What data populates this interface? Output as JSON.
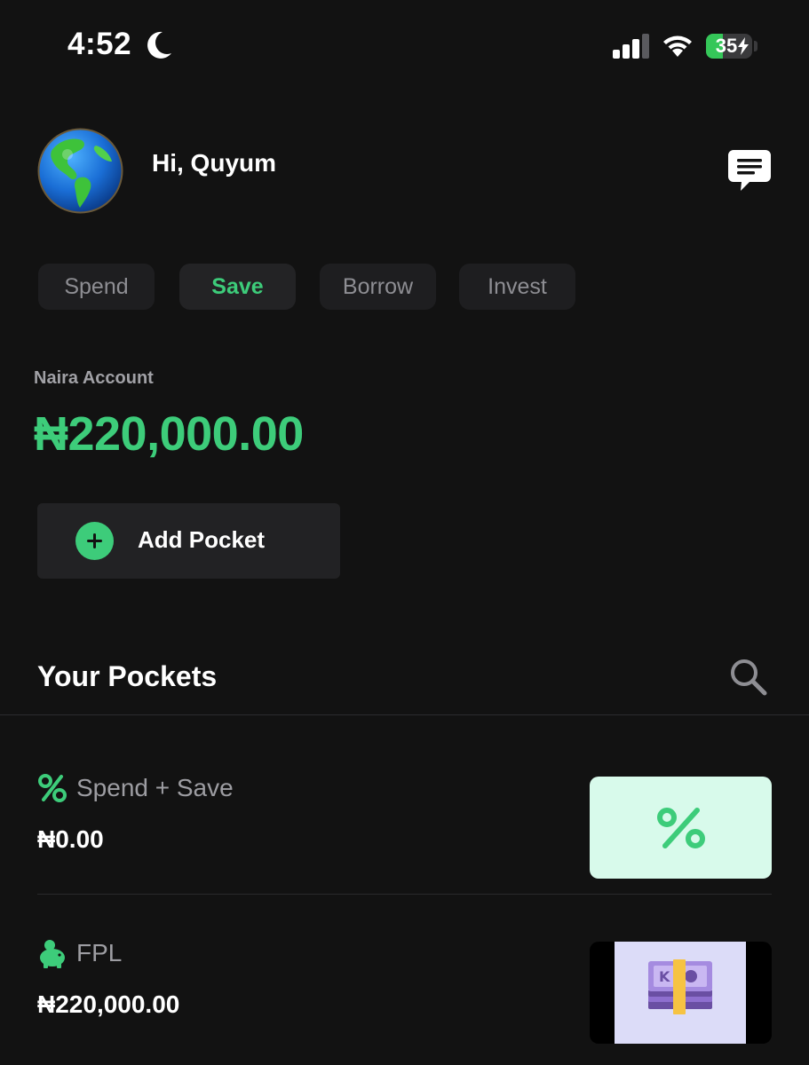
{
  "status_bar": {
    "time": "4:52",
    "battery": "35",
    "icons": [
      "moon-icon",
      "cellular-signal-icon",
      "wifi-icon",
      "battery-charging-icon"
    ]
  },
  "header": {
    "greeting": "Hi, Quyum",
    "avatar_icon": "globe-americas-icon",
    "chat_icon": "message-icon"
  },
  "tabs": [
    {
      "label": "Spend",
      "active": false
    },
    {
      "label": "Save",
      "active": true
    },
    {
      "label": "Borrow",
      "active": false
    },
    {
      "label": "Invest",
      "active": false
    }
  ],
  "account": {
    "label": "Naira Account",
    "balance": "₦220,000.00"
  },
  "add_pocket": {
    "label": "Add Pocket",
    "icon": "plus-circle-icon"
  },
  "pockets_section": {
    "title": "Your Pockets",
    "search_icon": "search-icon"
  },
  "pockets": [
    {
      "name": "Spend + Save",
      "amount": "₦0.00",
      "icon": "percent-icon",
      "thumb_glyph": "%"
    },
    {
      "name": "FPL",
      "amount": "₦220,000.00",
      "icon": "piggy-bank-icon",
      "thumb": "cash-stack-icon"
    }
  ],
  "colors": {
    "accent": "#3dcc7a",
    "background": "#121212",
    "card": "#222224",
    "thumb_mint": "#d8faeb"
  }
}
